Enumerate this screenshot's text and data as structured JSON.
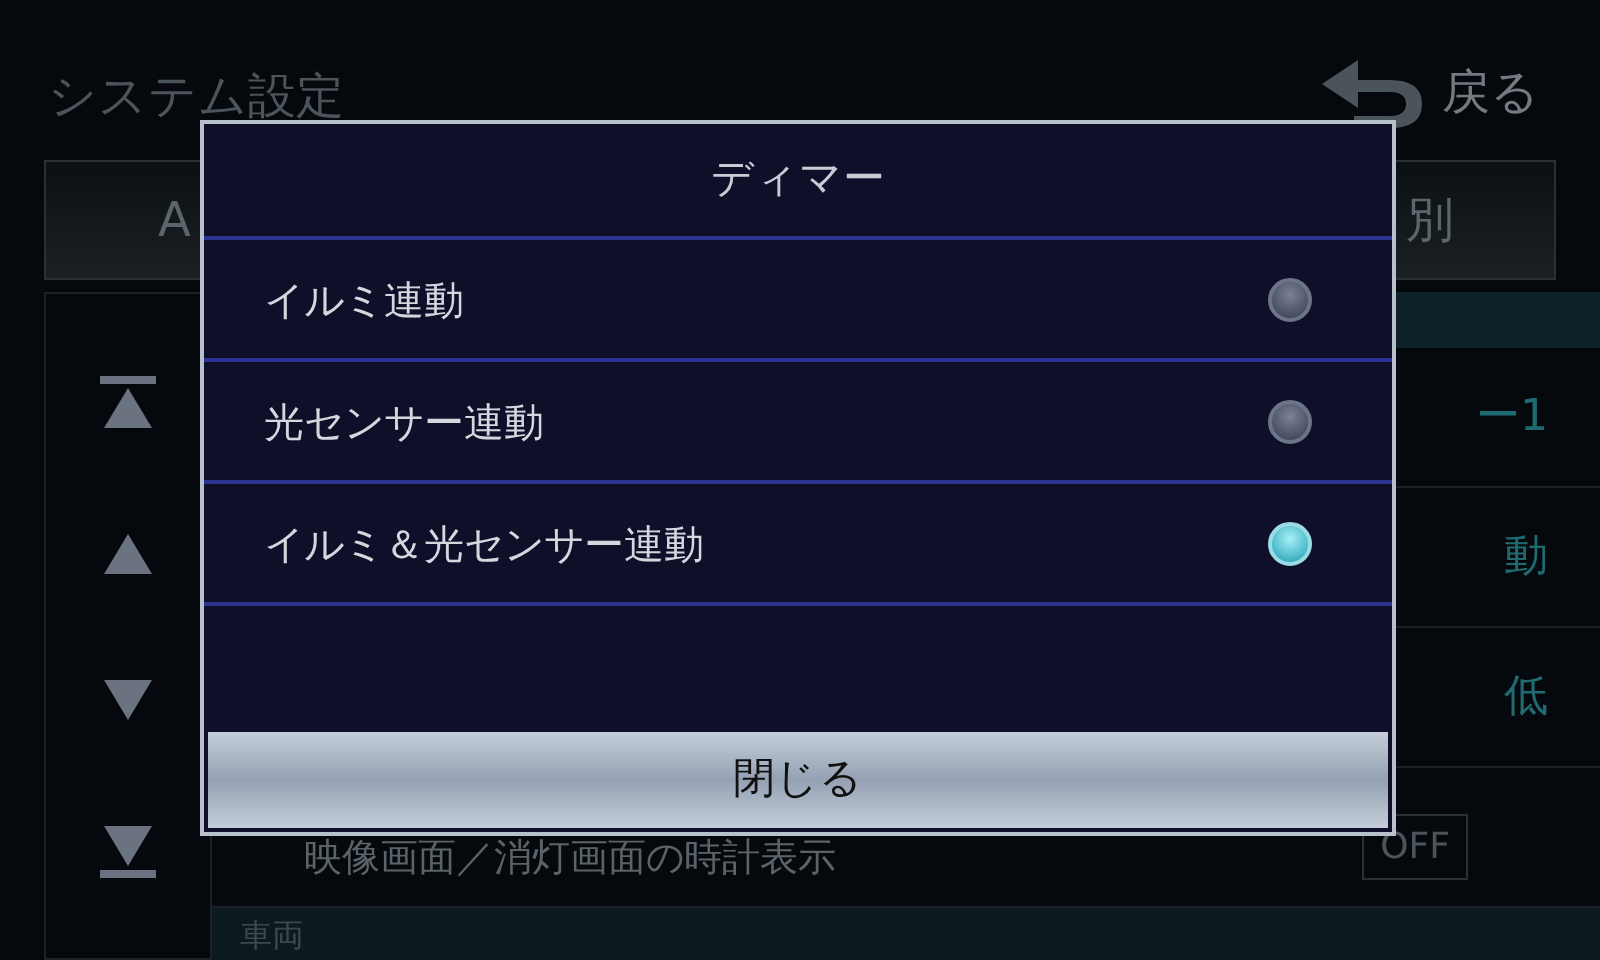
{
  "header": {
    "title": "システム設定",
    "back_button": "戻る"
  },
  "tabs": [
    {
      "label": "A",
      "selected": false
    },
    {
      "label": "別",
      "selected": false
    }
  ],
  "nav_buttons": [
    {
      "kind": "top"
    },
    {
      "kind": "up"
    },
    {
      "kind": "down"
    },
    {
      "kind": "bottom"
    }
  ],
  "setting_rows": [
    {
      "kind": "value",
      "value": "ー1"
    },
    {
      "kind": "value",
      "value": "動"
    },
    {
      "kind": "value",
      "value": "低"
    },
    {
      "kind": "toggle",
      "label": "映像画面／消灯画面の時計表示",
      "value": "OFF"
    }
  ],
  "section": "車両",
  "dialog": {
    "title": "ディマー",
    "options": [
      {
        "label": "イルミ連動",
        "selected": false
      },
      {
        "label": "光センサー連動",
        "selected": false
      },
      {
        "label": "イルミ＆光センサー連動",
        "selected": true
      }
    ],
    "close_button": "閉じる"
  }
}
